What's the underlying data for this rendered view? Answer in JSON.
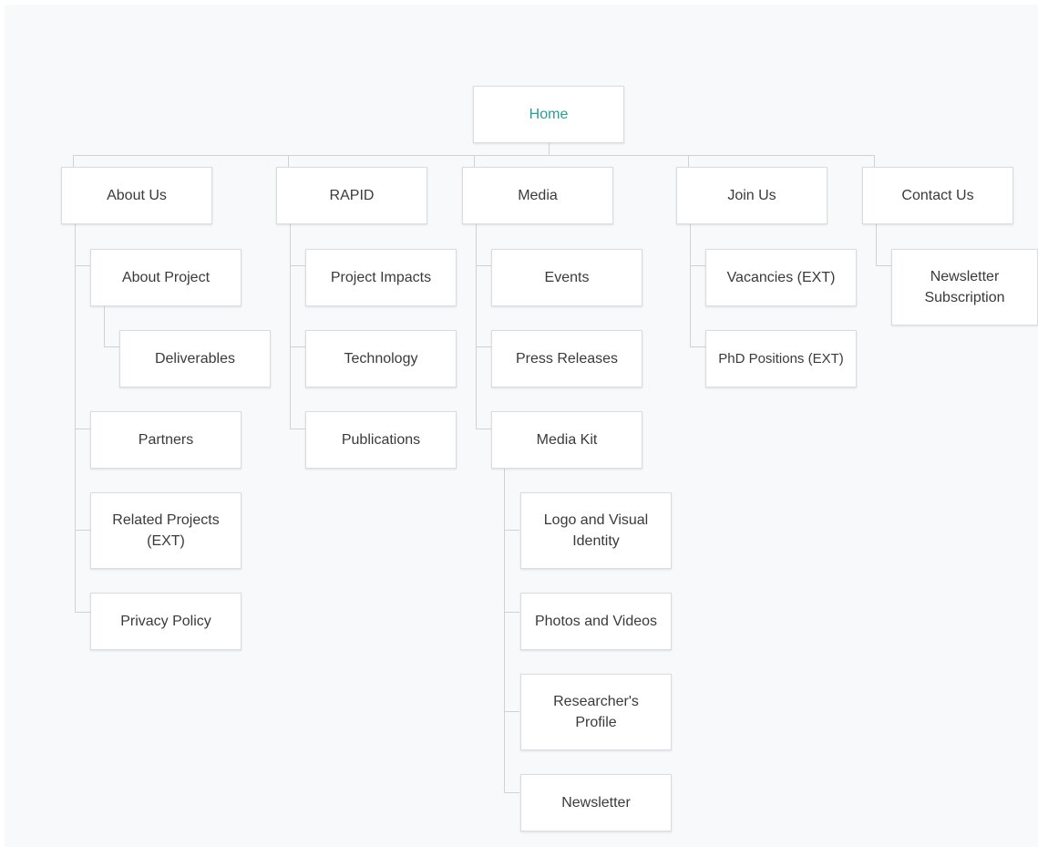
{
  "sitemap": {
    "root": {
      "label": "Home",
      "color": "#2a9d97"
    },
    "about_us": {
      "label": "About Us",
      "children": [
        "About Project",
        "Deliverables",
        "Partners",
        "Related Projects (EXT)",
        "Privacy Policy"
      ]
    },
    "rapid": {
      "label": "RAPID",
      "children": [
        "Project Impacts",
        "Technology",
        "Publications"
      ]
    },
    "media": {
      "label": "Media",
      "children": [
        "Events",
        "Press Releases",
        "Media Kit"
      ],
      "media_kit_children": [
        "Logo and Visual Identity",
        "Photos and Videos",
        "Researcher's Profile",
        "Newsletter"
      ]
    },
    "join_us": {
      "label": "Join Us",
      "children": [
        "Vacancies (EXT)",
        "PhD Positions (EXT)"
      ]
    },
    "contact_us": {
      "label": "Contact Us",
      "children": [
        "Newsletter Subscription"
      ]
    }
  }
}
